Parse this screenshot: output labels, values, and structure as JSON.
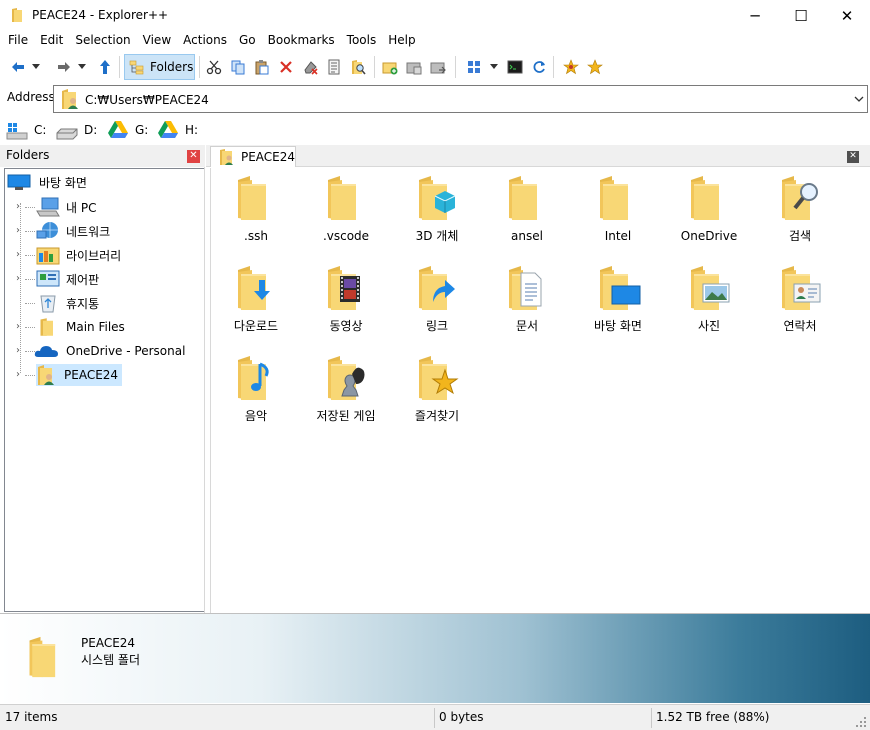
{
  "window": {
    "title": "PEACE24 - Explorer++",
    "minimize_glyph": "─",
    "maximize_glyph": "☐",
    "close_glyph": "✕"
  },
  "menu": [
    "File",
    "Edit",
    "Selection",
    "View",
    "Actions",
    "Go",
    "Bookmarks",
    "Tools",
    "Help"
  ],
  "toolbar": {
    "folders_label": "Folders",
    "icons": [
      "back-arrow-icon",
      "back-dropdown-icon",
      "forward-arrow-icon",
      "forward-dropdown-icon",
      "up-arrow-icon",
      "folders-icon",
      "cut-icon",
      "copy-icon",
      "paste-icon",
      "delete-icon",
      "delete-permanently-icon",
      "properties-icon",
      "search-icon",
      "new-folder-icon",
      "copy-to-icon",
      "move-to-icon",
      "views-icon",
      "views-dropdown-icon",
      "command-prompt-icon",
      "refresh-icon",
      "bookmark-tab-icon",
      "bookmarks-star-icon"
    ]
  },
  "address": {
    "label": "Address",
    "path": "C:₩Users₩PEACE24"
  },
  "drives": [
    {
      "label": "C:",
      "icon": "windows-drive-icon"
    },
    {
      "label": "D:",
      "icon": "hard-drive-icon"
    },
    {
      "label": "G:",
      "icon": "google-drive-icon"
    },
    {
      "label": "H:",
      "icon": "google-drive-icon"
    }
  ],
  "folders_pane": {
    "title": "Folders",
    "tree": [
      {
        "label": "바탕 화면",
        "icon": "desktop-icon",
        "level": 0
      },
      {
        "label": "내 PC",
        "icon": "computer-icon",
        "level": 1
      },
      {
        "label": "네트워크",
        "icon": "network-icon",
        "level": 1
      },
      {
        "label": "라이브러리",
        "icon": "libraries-icon",
        "level": 1
      },
      {
        "label": "제어판",
        "icon": "control-panel-icon",
        "level": 1
      },
      {
        "label": "휴지통",
        "icon": "recycle-bin-icon",
        "level": 1
      },
      {
        "label": "Main Files",
        "icon": "folder-icon",
        "level": 1
      },
      {
        "label": "OneDrive - Personal",
        "icon": "onedrive-icon",
        "level": 1
      },
      {
        "label": "PEACE24",
        "icon": "user-folder-icon",
        "level": 1,
        "selected": true
      }
    ]
  },
  "tab": {
    "label": "PEACE24"
  },
  "files": [
    {
      "name": ".ssh",
      "icon": "folder-icon"
    },
    {
      "name": ".vscode",
      "icon": "folder-icon"
    },
    {
      "name": "3D 개체",
      "icon": "3d-objects-folder-icon"
    },
    {
      "name": "ansel",
      "icon": "folder-icon"
    },
    {
      "name": "Intel",
      "icon": "folder-icon"
    },
    {
      "name": "OneDrive",
      "icon": "folder-icon"
    },
    {
      "name": "검색",
      "icon": "search-folder-icon"
    },
    {
      "name": "다운로드",
      "icon": "downloads-folder-icon"
    },
    {
      "name": "동영상",
      "icon": "videos-folder-icon"
    },
    {
      "name": "링크",
      "icon": "links-folder-icon"
    },
    {
      "name": "문서",
      "icon": "documents-folder-icon"
    },
    {
      "name": "바탕 화면",
      "icon": "desktop-folder-icon"
    },
    {
      "name": "사진",
      "icon": "pictures-folder-icon"
    },
    {
      "name": "연락처",
      "icon": "contacts-folder-icon"
    },
    {
      "name": "음악",
      "icon": "music-folder-icon"
    },
    {
      "name": "저장된 게임",
      "icon": "saved-games-folder-icon"
    },
    {
      "name": "즐겨찾기",
      "icon": "favorites-folder-icon"
    }
  ],
  "details": {
    "name": "PEACE24",
    "type": "시스템 폴더"
  },
  "status": {
    "items": "17 items",
    "size": "0 bytes",
    "free": "1.52 TB free (88%)"
  },
  "colors": {
    "folder_yellow": "#f8d775",
    "folder_dark": "#e6b84a",
    "selection": "#cce8ff",
    "accent_blue": "#1e88e5"
  }
}
